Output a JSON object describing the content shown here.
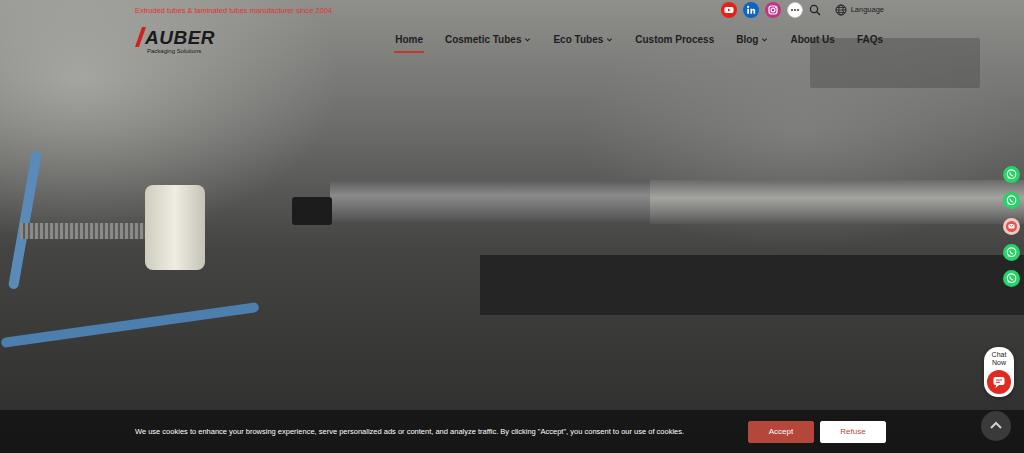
{
  "topbar": {
    "tagline": "Extruded tubes & laminated tubes manufacturer since 2004",
    "social": [
      {
        "kind": "youtube"
      },
      {
        "kind": "linkedin"
      },
      {
        "kind": "instagram"
      },
      {
        "kind": "more"
      }
    ],
    "language": "Language"
  },
  "logo": {
    "name": "AUBER",
    "subtitle": "Packaging Solutions"
  },
  "nav": [
    {
      "label": "Home",
      "selected": true,
      "dropdown": false
    },
    {
      "label": "Cosmetic Tubes",
      "selected": false,
      "dropdown": true
    },
    {
      "label": "Eco Tubes",
      "selected": false,
      "dropdown": true
    },
    {
      "label": "Custom Process",
      "selected": false,
      "dropdown": false
    },
    {
      "label": "Blog",
      "selected": false,
      "dropdown": true
    },
    {
      "label": "About Us",
      "selected": false,
      "dropdown": false
    },
    {
      "label": "FAQs",
      "selected": false,
      "dropdown": false
    }
  ],
  "float_buttons": [
    {
      "kind": "whatsapp"
    },
    {
      "kind": "whatsapp"
    },
    {
      "kind": "message"
    },
    {
      "kind": "whatsapp"
    },
    {
      "kind": "whatsapp"
    }
  ],
  "chat": {
    "label": "Chat Now"
  },
  "cookie_banner": {
    "text": "We use cookies to enhance your browsing experience, serve personalized ads or content, and analyze traffic. By clicking \"Accept\", you consent to our use of cookies.",
    "buttons": [
      {
        "label": "Accept",
        "kind": "primary"
      },
      {
        "label": "Refuse",
        "kind": "secondary"
      }
    ]
  }
}
